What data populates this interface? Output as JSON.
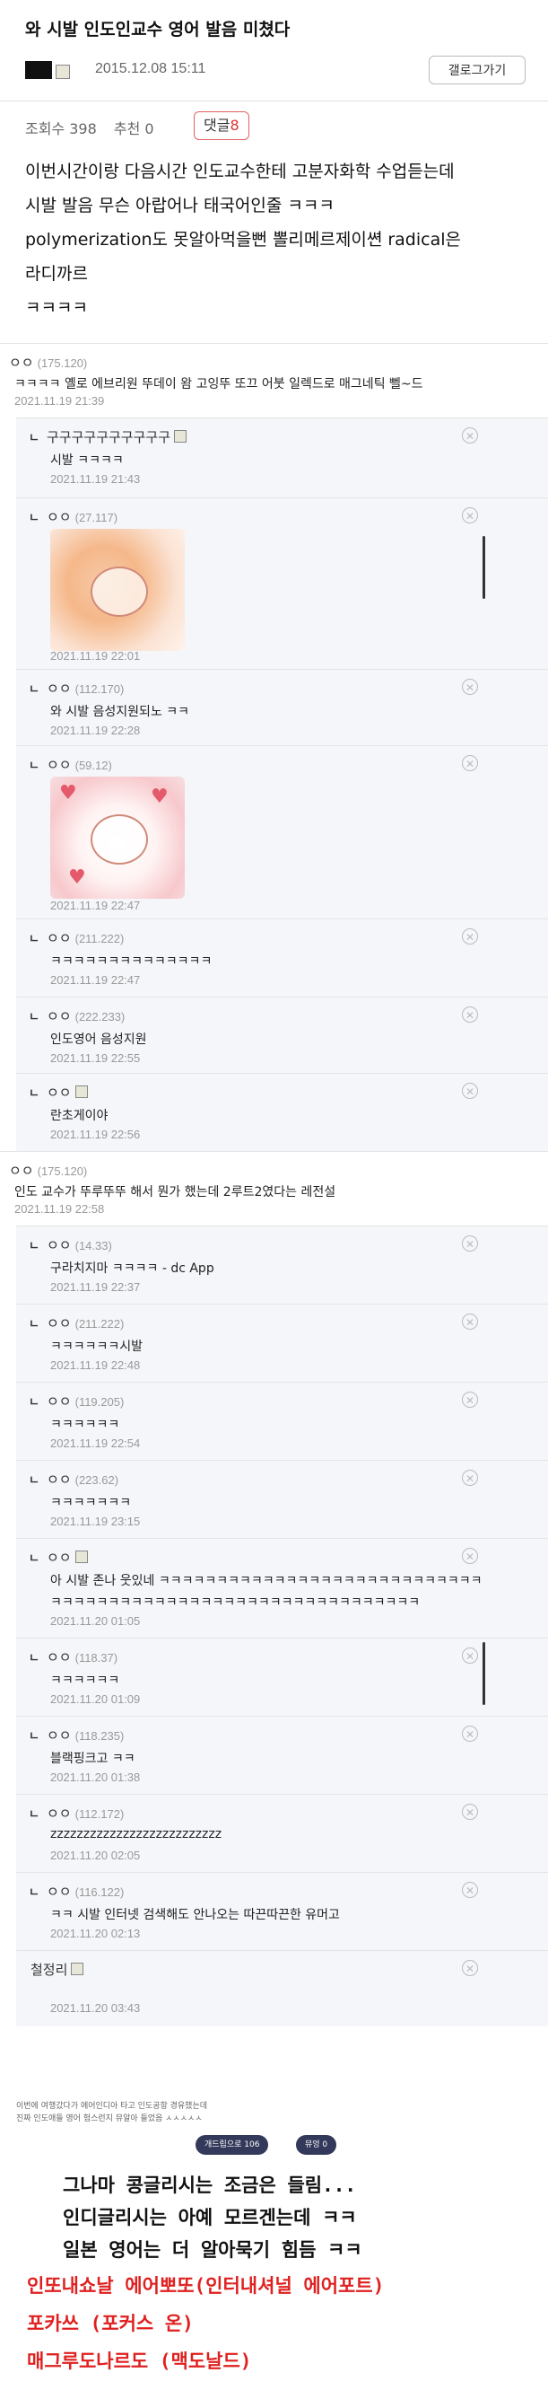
{
  "post": {
    "title": "와 시발 인도인교수 영어 발음 미쳤다",
    "date": "2015.12.08 15:11",
    "gallery_button": "갤로그가기",
    "views": "조회수 398",
    "recommend": "추천 0",
    "comment_label": "댓글",
    "comment_count": "8",
    "body": [
      "이번시간이랑 다음시간 인도교수한테 고분자화학 수업듣는데",
      "시발 발음 무슨 아랍어나 태국어인줄 ㅋㅋㅋ",
      "polymerization도 못알아먹을뻔 뽈리메르제이쎤 radical은",
      "라디까르",
      "ㅋㅋㅋㅋ"
    ]
  },
  "comments": [
    {
      "nick": "ㅇㅇ",
      "ip": "(175.120)",
      "text": "ㅋㅋㅋㅋ 옐로 에브리원 뚜데이 왐 고잉뚜 또끄 어붓 일렉드로 매그네틱 뻴~드",
      "time": "2021.11.19 21:39"
    },
    {
      "nick": "구구구구구구구구구구",
      "text": "시발 ㅋㅋㅋㅋ",
      "time": "2021.11.19 21:43"
    },
    {
      "nick": "ㅇㅇ",
      "ip": "(27.117)",
      "time": "2021.11.19 22:01"
    },
    {
      "nick": "ㅇㅇ",
      "ip": "(112.170)",
      "text": "와 시발 음성지원되노 ㅋㅋ",
      "time": "2021.11.19 22:28"
    },
    {
      "nick": "ㅇㅇ",
      "ip": "(59.12)",
      "time": "2021.11.19 22:47"
    },
    {
      "nick": "ㅇㅇ",
      "ip": "(211.222)",
      "text": "ㅋㅋㅋㅋㅋㅋㅋㅋㅋㅋㅋㅋㅋㅋ",
      "time": "2021.11.19 22:47"
    },
    {
      "nick": "ㅇㅇ",
      "ip": "(222.233)",
      "text": "인도영어 음성지원",
      "time": "2021.11.19 22:55"
    },
    {
      "nick": "ㅇㅇ",
      "text": "란초게이야",
      "time": "2021.11.19 22:56"
    },
    {
      "nick": "ㅇㅇ",
      "ip": "(175.120)",
      "text": "인도 교수가 뚜루뚜뚜 해서 뭔가 했는데 2루트2였다는 레전설",
      "time": "2021.11.19 22:58"
    },
    {
      "nick": "ㅇㅇ",
      "ip": "(14.33)",
      "text": "구라치지마 ㅋㅋㅋㅋ - dc App",
      "time": "2021.11.19 22:37"
    },
    {
      "nick": "ㅇㅇ",
      "ip": "(211.222)",
      "text": "ㅋㅋㅋㅋㅋㅋ시발",
      "time": "2021.11.19 22:48"
    },
    {
      "nick": "ㅇㅇ",
      "ip": "(119.205)",
      "text": "ㅋㅋㅋㅋㅋㅋ",
      "time": "2021.11.19 22:54"
    },
    {
      "nick": "ㅇㅇ",
      "ip": "(223.62)",
      "text": "ㅋㅋㅋㅋㅋㅋㅋ",
      "time": "2021.11.19 23:15"
    },
    {
      "nick": "ㅇㅇ",
      "text": "아 시발 존나 웃있네 ㅋㅋㅋㅋㅋㅋㅋㅋㅋㅋㅋㅋㅋㅋㅋㅋㅋㅋㅋㅋㅋㅋㅋㅋㅋㅋㅋㅋ",
      "text2": "ㅋㅋㅋㅋㅋㅋㅋㅋㅋㅋㅋㅋㅋㅋㅋㅋㅋㅋㅋㅋㅋㅋㅋㅋㅋㅋㅋㅋㅋㅋㅋㅋ",
      "time": "2021.11.20 01:05"
    },
    {
      "nick": "ㅇㅇ",
      "ip": "(118.37)",
      "text": "ㅋㅋㅋㅋㅋㅋ",
      "time": "2021.11.20 01:09"
    },
    {
      "nick": "ㅇㅇ",
      "ip": "(118.235)",
      "text": "블랙핑크고 ㅋㅋ",
      "time": "2021.11.20 01:38"
    },
    {
      "nick": "ㅇㅇ",
      "ip": "(112.172)",
      "text": "zzzzzzzzzzzzzzzzzzzzzzzzzz",
      "time": "2021.11.20 02:05"
    },
    {
      "nick": "ㅇㅇ",
      "ip": "(116.122)",
      "text": "ㅋㅋ 시발 인터넷 검색해도 안나오는 따끈따끈한 유머고",
      "time": "2021.11.20 02:13"
    },
    {
      "nick": "철정리",
      "time": "2021.11.20 03:43"
    }
  ],
  "footer": {
    "note1": "이번에 여행갔다가 에어인디아 타고 인도공항 경유했는데",
    "note2": "진짜 인도애들 영어 험스런지 뮤알아 들었음 ㅅㅅㅅㅅㅅ",
    "pill1": "개드립으로 106",
    "pill2": "뮤엉 0"
  },
  "caption": [
    "그나마 콩글리시는 조금은 들림...",
    "인디글리시는 아예 모르겐는데 ㅋㅋ",
    "일본 영어는 더 알아묵기 힘듬 ㅋㅋ",
    "인또내쇼날 에어뽀또(인터내셔널 에어포트)",
    "포카쓰 (포커스 온)",
    "매그루도나르도 (맥도날드)"
  ],
  "colors": {
    "accent": "#d33333",
    "caption_red": "#e02020",
    "pill": "#33395a"
  }
}
